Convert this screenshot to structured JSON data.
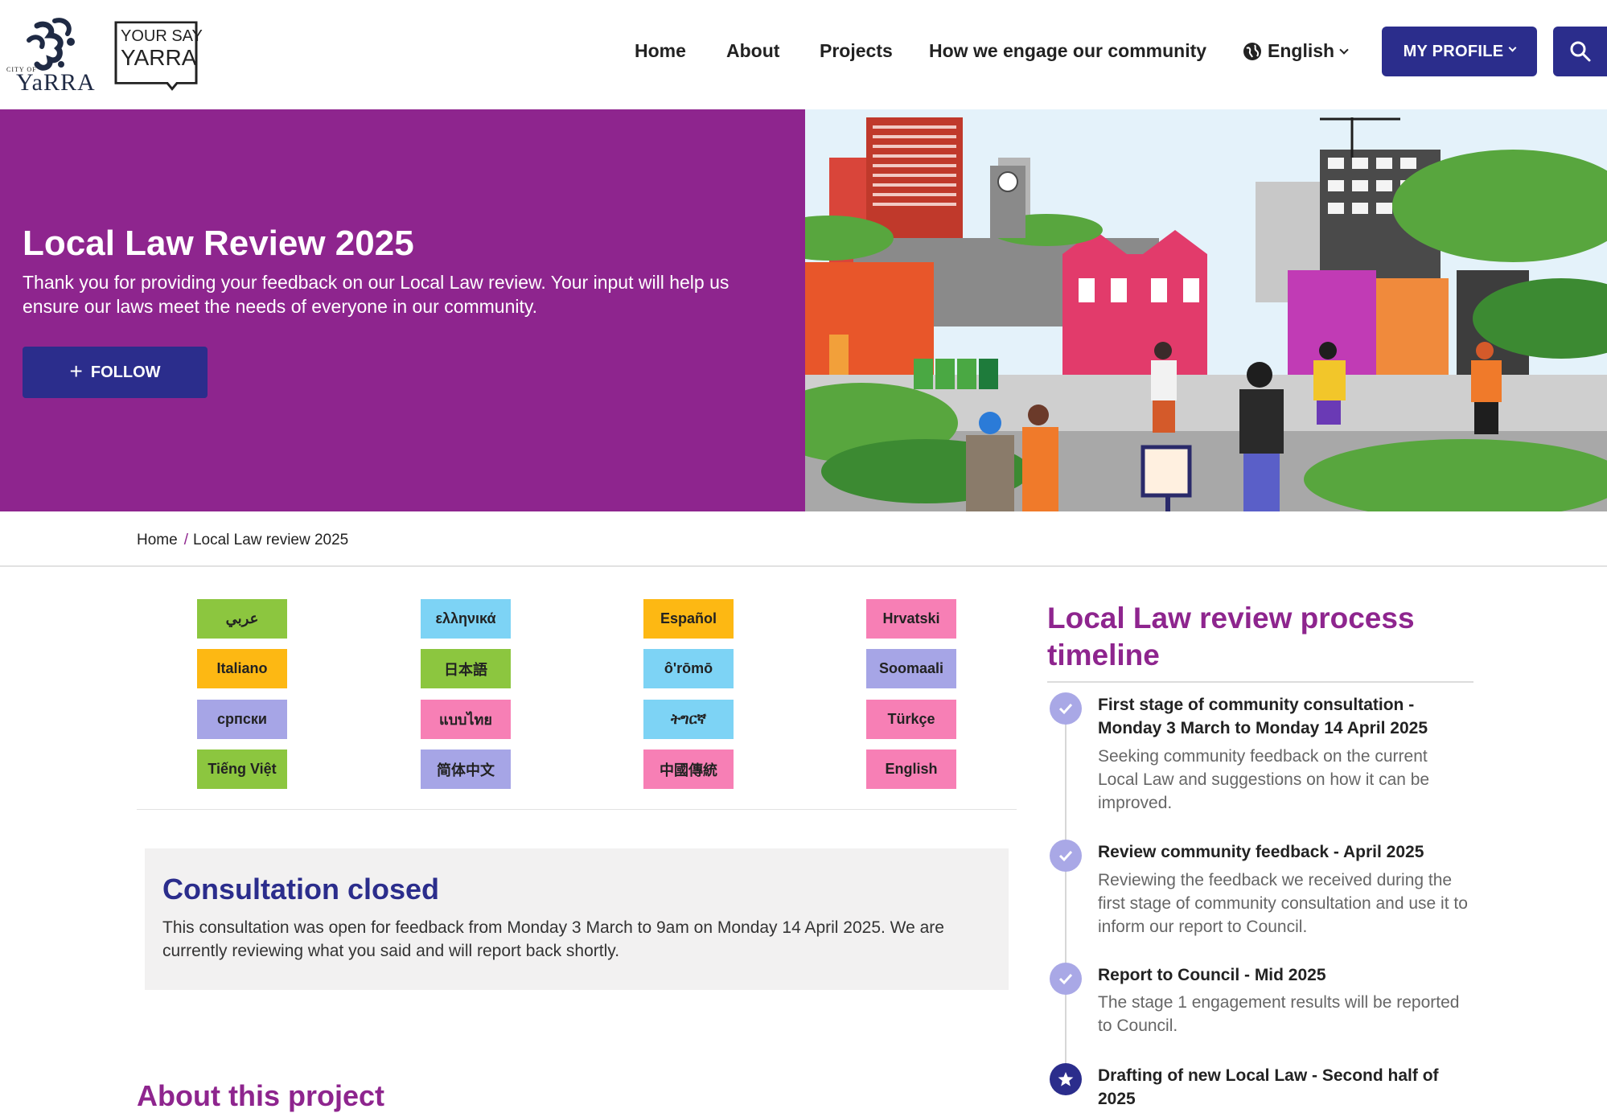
{
  "header": {
    "logo_city_of": "CITY OF",
    "logo_yarra": "YaRRA",
    "logo_your_say_line1": "YOUR SAY",
    "logo_your_say_line2": "YARRA",
    "nav": [
      "Home",
      "About",
      "Projects",
      "How we engage our community"
    ],
    "language": "English",
    "profile_label": "MY PROFILE"
  },
  "hero": {
    "title": "Local Law Review 2025",
    "description": "Thank you for providing your feedback on our Local Law review. Your input will help us ensure our laws meet the needs of everyone in our community.",
    "follow_label": "FOLLOW"
  },
  "breadcrumb": {
    "home": "Home",
    "separator": "/",
    "current": "Local Law review 2025"
  },
  "languages": [
    "عربي",
    "ελληνικά",
    "Español",
    "Hrvatski",
    "Italiano",
    "日本語",
    "ô'rōmō",
    "Soomaali",
    "српски",
    "แบบไทย",
    "ትግርኛ",
    "Türkçe",
    "Tiếng Việt",
    "简体中文",
    "中國傳統",
    "English"
  ],
  "consultation": {
    "title": "Consultation closed",
    "body": "This consultation was open for feedback from Monday 3 March to 9am on Monday 14 April 2025. We are currently reviewing what you said and will report back shortly."
  },
  "about_heading": "About this project",
  "timeline": {
    "title": "Local Law review process timeline",
    "items": [
      {
        "heading": "First stage of community consultation - Monday 3 March to Monday 14 April 2025",
        "text": "Seeking community feedback on the current Local Law and suggestions on how it can be improved."
      },
      {
        "heading": "Review community feedback - April 2025",
        "text": "Reviewing the feedback we received during the first stage of community consultation and use it to inform our report to Council."
      },
      {
        "heading": "Report to Council - Mid 2025",
        "text": "The stage 1 engagement results will be reported to Council."
      },
      {
        "heading": "Drafting of new Local Law - Second half of 2025",
        "text": ""
      }
    ]
  },
  "colors": {
    "brand_purple": "#8e258e",
    "brand_navy": "#2b2d8c",
    "timeline_done": "#a9a8e6"
  }
}
